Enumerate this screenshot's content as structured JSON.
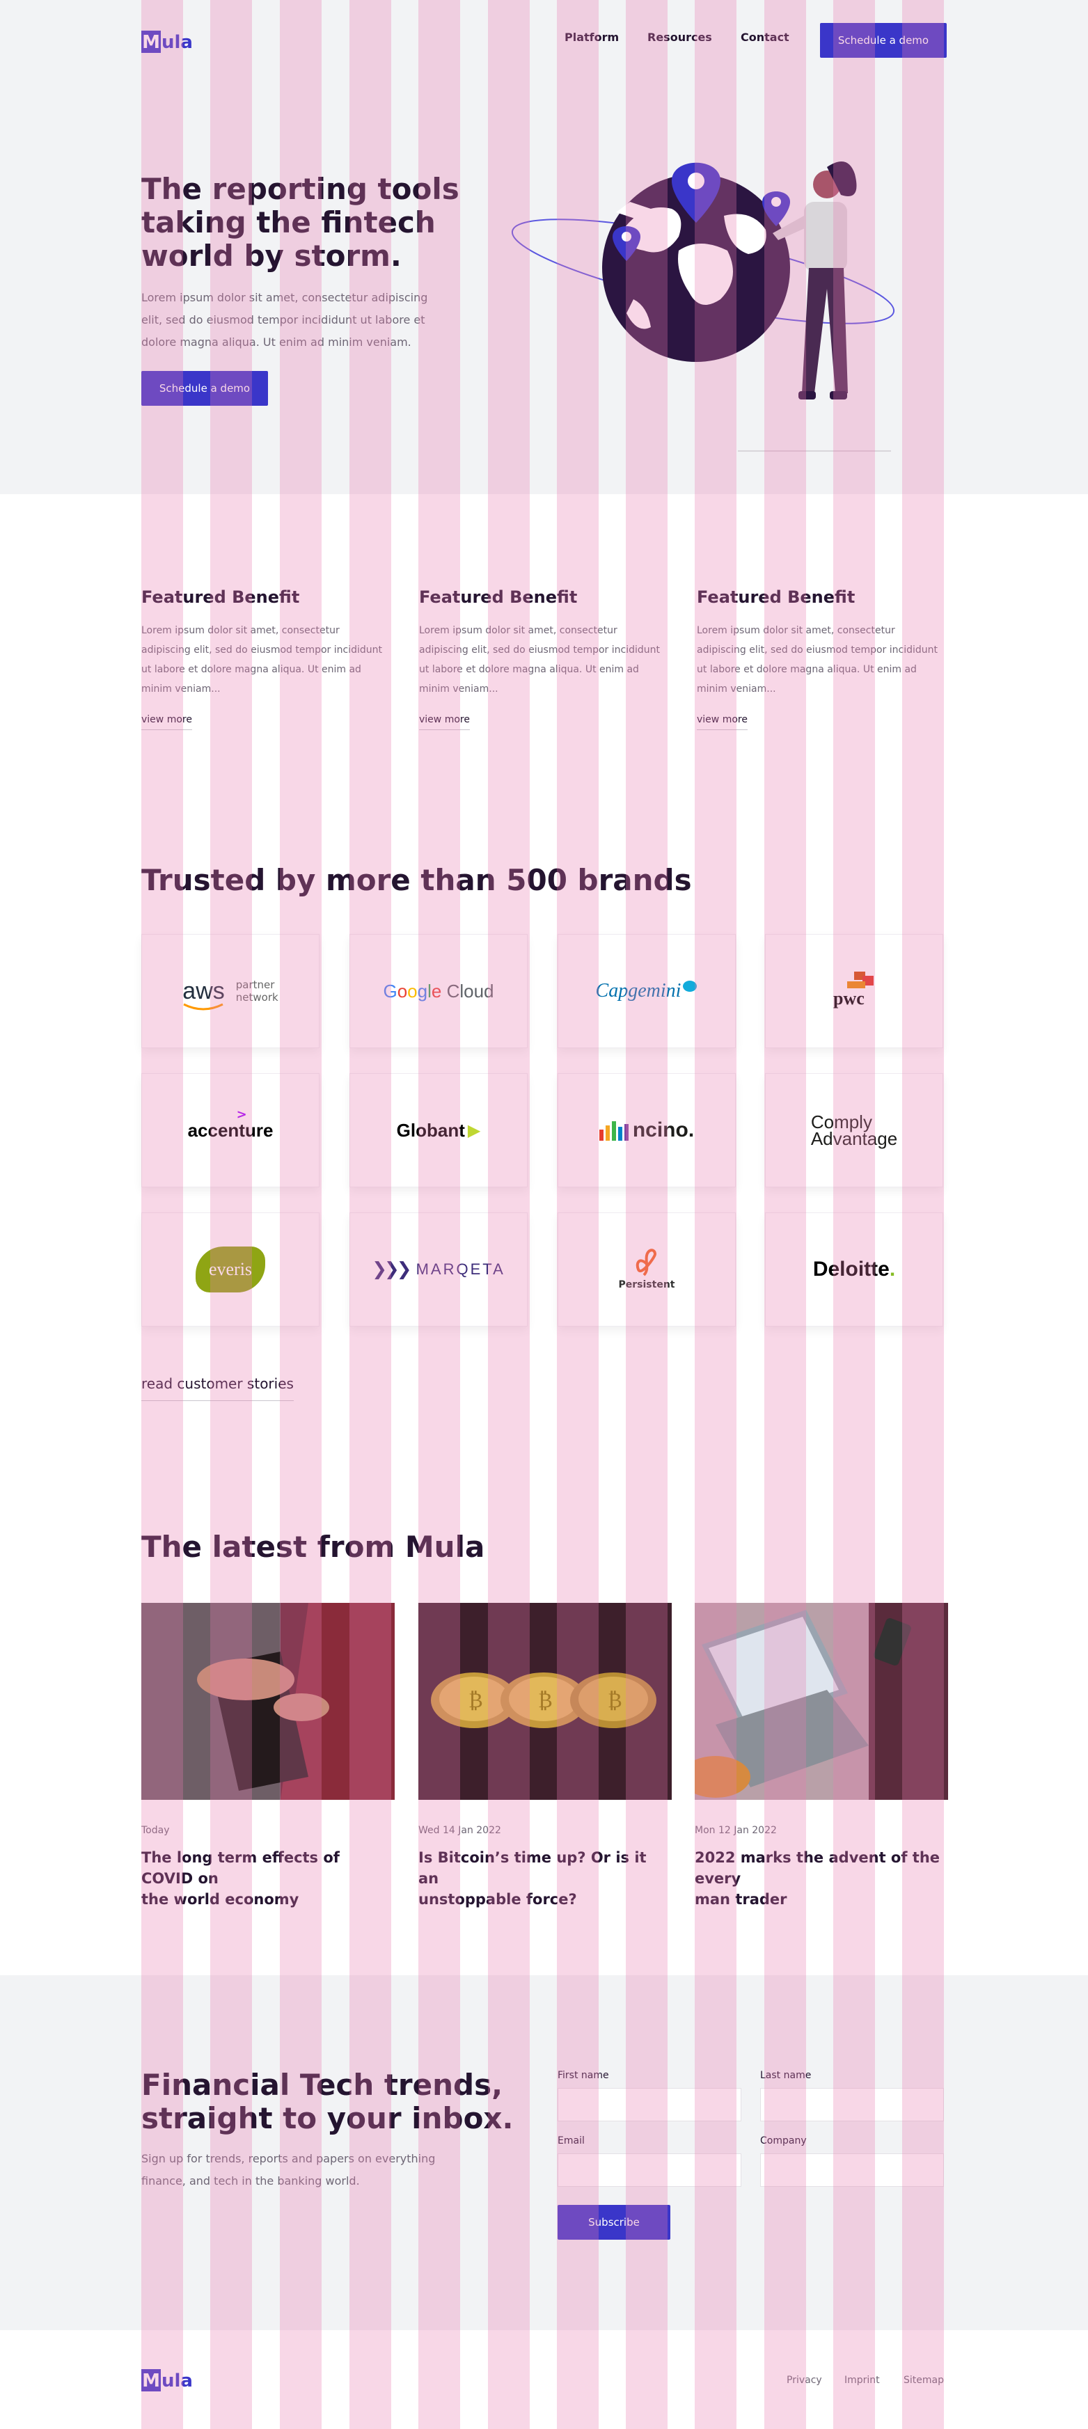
{
  "header": {
    "logo_m": "M",
    "logo_rest": "ula",
    "nav": [
      "Platform",
      "Resources",
      "Contact"
    ],
    "cta": "Schedule a demo"
  },
  "hero": {
    "title_lines": [
      "The reporting tools",
      "taking the fintech",
      "world by storm."
    ],
    "body_lines": [
      "Lorem ipsum dolor sit amet, consectetur adipiscing",
      "elit, sed do eiusmod tempor incididunt ut labore et",
      "dolore magna aliqua. Ut enim ad minim veniam."
    ],
    "cta": "Schedule a demo"
  },
  "benefits": [
    {
      "title": "Featured Benefit",
      "lines": [
        "Lorem ipsum dolor sit amet, consectetur",
        "adipiscing elit, sed do eiusmod tempor incididunt",
        "ut labore et dolore magna aliqua. Ut enim ad",
        "minim veniam..."
      ],
      "link": "view more"
    },
    {
      "title": "Featured Benefit",
      "lines": [
        "Lorem ipsum dolor sit amet, consectetur",
        "adipiscing elit, sed do eiusmod tempor incididunt",
        "ut labore et dolore magna aliqua. Ut enim ad",
        "minim veniam..."
      ],
      "link": "view more"
    },
    {
      "title": "Featured Benefit",
      "lines": [
        "Lorem ipsum dolor sit amet, consectetur",
        "adipiscing elit, sed do eiusmod tempor incididunt",
        "ut labore et dolore magna aliqua. Ut enim ad",
        "minim veniam..."
      ],
      "link": "view more"
    }
  ],
  "brands": {
    "title": "Trusted by more than 500 brands",
    "logos": {
      "aws": "aws",
      "aws_sub1": "partner",
      "aws_sub2": "network",
      "google_g": "G",
      "google_o1": "o",
      "google_o2": "o",
      "google_g2": "g",
      "google_l": "l",
      "google_e": "e",
      "google_cloud": " Cloud",
      "capgemini": "Capgemini",
      "pwc": "pwc",
      "accenture": "accenture",
      "globant": "Globant",
      "ncino": "ncino.",
      "comply1": "Comply",
      "comply2": "Advantage",
      "everis": "everis",
      "marqeta": "MARQETA",
      "persistent": "Persistent",
      "deloitte": "Deloitte",
      "deloitte_dot": "."
    },
    "link": "read customer stories"
  },
  "latest": {
    "title": "The latest from Mula",
    "posts": [
      {
        "date": "Today",
        "title_lines": [
          "The long term effects of COVID on",
          "the world economy"
        ]
      },
      {
        "date": "Wed 14 Jan 2022",
        "title_lines": [
          "Is Bitcoin’s time up? Or is it an",
          "unstoppable force?"
        ]
      },
      {
        "date": "Mon 12 Jan 2022",
        "title_lines": [
          "2022 marks the advent of the every",
          "man trader"
        ]
      }
    ]
  },
  "newsletter": {
    "title_lines": [
      "Financial Tech trends,",
      "straight to your inbox."
    ],
    "body_lines": [
      "Sign up for trends, reports and papers on everything",
      "finance, and tech in the banking world."
    ],
    "labels": {
      "first": "First name",
      "last": "Last name",
      "email": "Email",
      "company": "Company"
    },
    "submit": "Subscribe"
  },
  "footer": {
    "logo_m": "M",
    "logo_rest": "ula",
    "links": [
      "Privacy",
      "Imprint",
      "Sitemap"
    ]
  },
  "colors": {
    "brand": "#3a36c9",
    "ink": "#241430",
    "muted": "#6e6675",
    "stripe": "#e97cb0",
    "bg_grey": "#f2f3f5"
  }
}
